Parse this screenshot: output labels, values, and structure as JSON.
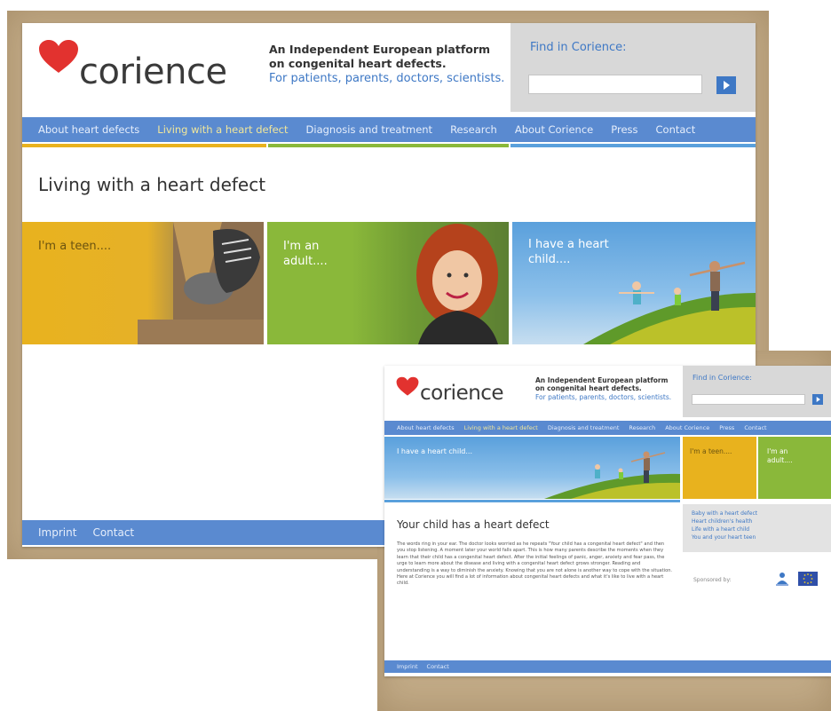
{
  "brand": {
    "logo_text": "corience",
    "heart_color": "#e2322f",
    "accent_blue": "#3e78c5",
    "nav_blue": "#5a8ad0"
  },
  "tagline": {
    "line1": "An Independent European platform",
    "line2": "on congenital heart defects.",
    "line3": "For patients, parents, doctors, scientists."
  },
  "search": {
    "label": "Find in Corience:",
    "placeholder": "",
    "button_icon": "arrow-right-icon"
  },
  "nav": {
    "items": [
      "About heart defects",
      "Living with a heart defect",
      "Diagnosis and treatment",
      "Research",
      "About Corience",
      "Press",
      "Contact"
    ],
    "active_index": 1
  },
  "page1": {
    "title": "Living with a heart defect",
    "tiles": [
      {
        "label": "I'm a teen....",
        "color": "#e8b21e"
      },
      {
        "label": "I'm an adult....",
        "color": "#8ab83a"
      },
      {
        "label": "I have a heart child....",
        "color": "#5aa0dc"
      }
    ]
  },
  "page2": {
    "banner_label": "I have a heart child...",
    "side_tiles": [
      {
        "label": "I'm a teen....",
        "color": "#e8b21e"
      },
      {
        "label": "I'm an adult....",
        "color": "#8ab83a"
      }
    ],
    "title": "Your child has a heart defect",
    "body": "The words ring in your ear. The doctor looks worried as he repeats \"Your child has a congenital heart defect\" and then you stop listening. A moment later your world falls apart. This is how many parents describe the moments when they learn that their child has a congenital heart defect. After the initial feelings of panic, anger, anxiety and fear pass, the urge to learn more about the disease and living with a congenital heart defect grows stronger. Reading and understanding is a way to diminish the anxiety. Knowing that you are not alone is another way to cope with the situation. Here at Corience you will find a lot of information about congenital heart defects and what it's like to live with a heart child.",
    "sidebar_links": [
      "Baby with a heart defect",
      "Heart children's health",
      "Life with a heart child",
      "You and your heart teen"
    ],
    "sponsored_label": "Sponsored by:"
  },
  "footer": {
    "links": [
      "Imprint",
      "Contact"
    ]
  }
}
